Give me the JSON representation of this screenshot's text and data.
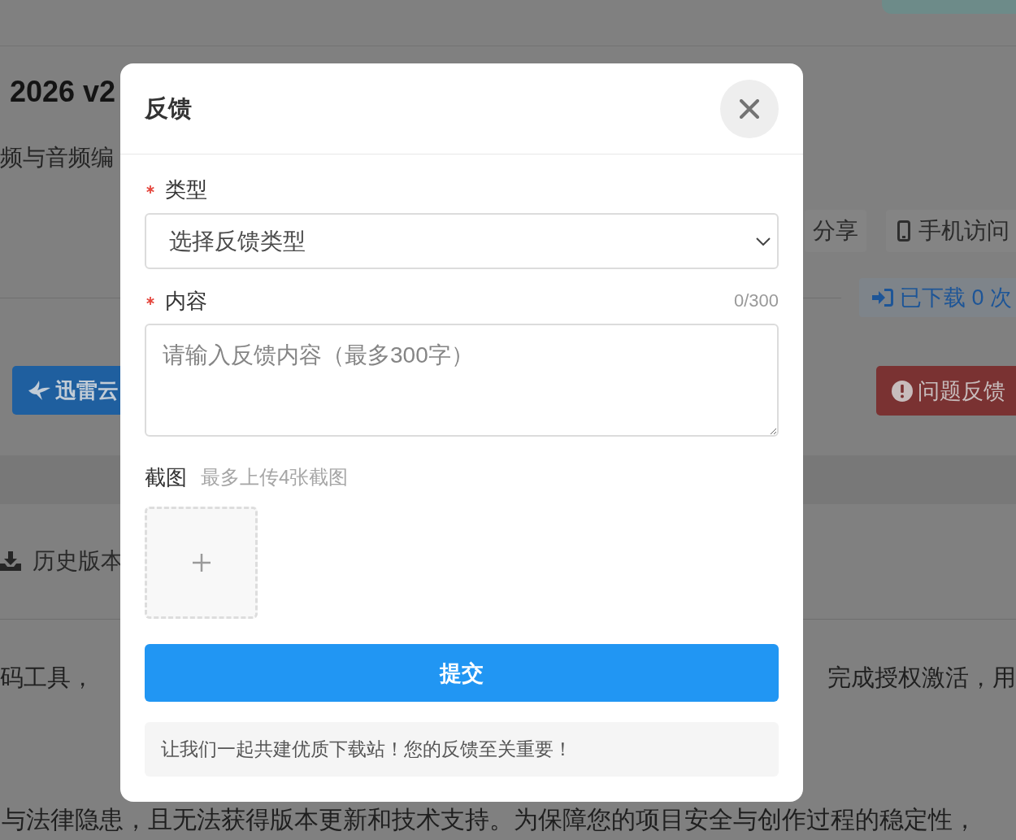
{
  "page": {
    "title": "2026 v2",
    "subtitle": "频与音频编",
    "actions": [
      {
        "kind": "share",
        "label": "分享"
      },
      {
        "kind": "mobile",
        "label": "手机访问"
      }
    ],
    "download_count": "已下载 0 次",
    "cloud_button": "迅雷云",
    "report_button": "问题反馈",
    "history_link": "历史版本",
    "body_text": {
      "line_left": "码工具，",
      "line_right": "完成授权激活，用",
      "last_line": "与法律隐患，且无法获得版本更新和技术支持。为保障您的项目安全与创作过程的稳定性，"
    }
  },
  "dialog": {
    "title": "反馈",
    "fields": [
      {
        "kind": "select",
        "label": "类型",
        "required": true,
        "placeholder": "选择反馈类型"
      },
      {
        "kind": "textarea",
        "label": "内容",
        "required": true,
        "counter": "0/300",
        "placeholder": "请输入反馈内容（最多300字）"
      }
    ],
    "screenshots": {
      "label": "截图",
      "hint": "最多上传4张截图"
    },
    "submit": "提交",
    "notice": "让我们一起共建优质下载站！您的反馈至关重要！"
  }
}
